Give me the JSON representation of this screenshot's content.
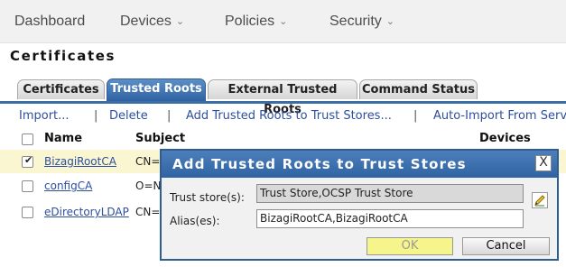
{
  "nav": [
    {
      "label": "Dashboard",
      "has_menu": false
    },
    {
      "label": "Devices",
      "has_menu": true
    },
    {
      "label": "Policies",
      "has_menu": true
    },
    {
      "label": "Security",
      "has_menu": true
    }
  ],
  "section_title": "Certificates",
  "tabs": [
    "Certificates",
    "Trusted Roots",
    "External Trusted Roots",
    "Command Status"
  ],
  "active_tab": "Trusted Roots",
  "actions": {
    "import": "Import...",
    "delete": "Delete",
    "add_trusted": "Add Trusted Roots to Trust Stores...",
    "auto_import": "Auto-Import From Serv",
    "separator": "|"
  },
  "table": {
    "columns": [
      "Name",
      "Subject",
      "Devices"
    ],
    "rows": [
      {
        "name": "BizagiRootCA",
        "subject": "CN=A",
        "checked": true
      },
      {
        "name": "configCA",
        "subject": "O=Ne",
        "checked": false
      },
      {
        "name": "eDirectoryLDAP",
        "subject": "CN=N",
        "checked": false
      }
    ]
  },
  "dialog": {
    "title": "Add Trusted Roots to Trust Stores",
    "close": "X",
    "trust_store_label": "Trust store(s):",
    "trust_store_value": "Trust Store,OCSP Trust Store",
    "alias_label": "Alias(es):",
    "alias_value": "BizagiRootCA,BizagiRootCA",
    "ok_label": "OK",
    "cancel_label": "Cancel"
  },
  "colors": {
    "accent": "#2f63a2",
    "link": "#2d4f9e",
    "selected_row": "#fbf6d2",
    "ok_highlight": "#f5f58b"
  }
}
